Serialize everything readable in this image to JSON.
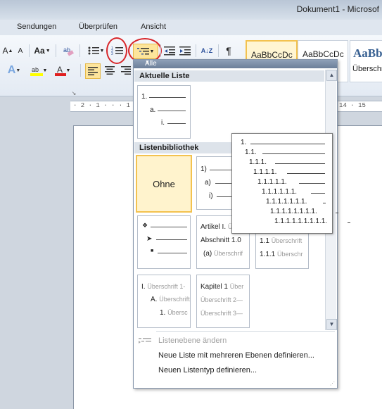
{
  "window": {
    "title": "Dokument1 - Microsof"
  },
  "tabs": [
    "Sendungen",
    "Überprüfen",
    "Ansicht"
  ],
  "ribbon": {
    "font_size_grow": "A",
    "change_case": "Aa",
    "sort_label": "A↓Z",
    "pilcrow": "¶",
    "styles": [
      {
        "preview": "AaBbCcDc",
        "caption": "",
        "selected": true
      },
      {
        "preview": "AaBbCcDc",
        "caption": ""
      },
      {
        "preview": "AaBb",
        "caption": "Überschri"
      }
    ]
  },
  "gallery": {
    "filter_label": "Alle",
    "current_section": "Aktuelle Liste",
    "library_section": "Listenbibliothek",
    "current_list": [
      "1.",
      "a.",
      "i."
    ],
    "none_label": "Ohne",
    "list_1ai": [
      "1)",
      "a)",
      "i)"
    ],
    "article_list": {
      "l1": "Artikel I.",
      "l1_gray": "Über",
      "l2": "Abschnitt 1.0",
      "l3": "(a)",
      "l3_gray": "Überschrif"
    },
    "heading_numbered": {
      "l1": "1.1",
      "l1_gray": "Überschrift",
      "l2": "1.1.1",
      "l2_gray": "Überschr"
    },
    "roman_list": {
      "l1": "I.",
      "l1_gray": "Überschrift 1-",
      "l2": "A.",
      "l2_gray": "Überschrift",
      "l3": "1.",
      "l3_gray": "Übersc"
    },
    "chapter_list": {
      "l1": "Kapitel 1",
      "l1_gray": "Über",
      "l2_gray": "Überschrift 2—",
      "l3_gray": "Überschrift 3—"
    },
    "menu": [
      {
        "label": "Listenebene ändern",
        "disabled": true
      },
      {
        "label": "Neue Liste mit mehreren Ebenen definieren..."
      },
      {
        "label": "Neuen Listentyp definieren..."
      }
    ]
  },
  "tooltip": {
    "rows": [
      "1.",
      "1.1.",
      "1.1.1.",
      "1.1.1.1.",
      "1.1.1.1.1.",
      "1.1.1.1.1.1.",
      "1.1.1.1.1.1.1.",
      "1.1.1.1.1.1.1.1.",
      "1.1.1.1.1.1.1.1.1."
    ]
  },
  "ruler": {
    "text": "· 2 · 1 · ·  · 1 · 2 · 3 · 4 · 5 · 6 · 7 · 8 · 9 · 10 · 11 · 12 · 13 · 14 · 15"
  },
  "colors": {
    "highlight_circle": "#d8262a",
    "selection_gold": "#f3c24f"
  }
}
